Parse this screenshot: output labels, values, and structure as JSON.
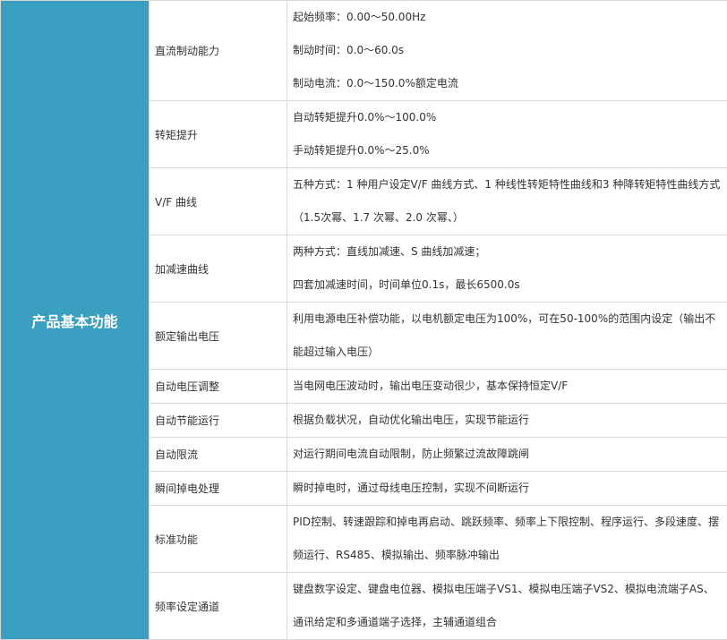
{
  "category": "产品基本功能",
  "rows": [
    {
      "label": "直流制动能力",
      "lines": [
        "起始频率：0.00～50.00Hz",
        "制动时间：0.0～60.0s",
        "制动电流：0.0～150.0%额定电流"
      ]
    },
    {
      "label": "转矩提升",
      "lines": [
        "自动转矩提升0.0%～100.0%",
        "手动转矩提升0.0%～25.0%"
      ]
    },
    {
      "label": "V/F 曲线",
      "lines": [
        "五种方式：1 种用户设定V/F 曲线方式、1 种线性转矩特性曲线和3 种降转矩特性曲线方式",
        "（1.5次幂、1.7 次幂、2.0 次幂、）"
      ]
    },
    {
      "label": "加减速曲线",
      "lines": [
        "两种方式：直线加减速、S 曲线加减速；",
        "四套加减速时间，时间单位0.1s，最长6500.0s"
      ]
    },
    {
      "label": "额定输出电压",
      "lines": [
        "利用电源电压补偿功能，以电机额定电压为100%，可在50-100%的范围内设定（输出不",
        "能超过输入电压）"
      ]
    },
    {
      "label": "自动电压调整",
      "lines": [
        "当电网电压波动时，输出电压变动很少，基本保持恒定V/F"
      ]
    },
    {
      "label": "自动节能运行",
      "lines": [
        "根据负载状况，自动优化输出电压，实现节能运行"
      ]
    },
    {
      "label": "自动限流",
      "lines": [
        "对运行期间电流自动限制，防止频繁过流故障跳闸"
      ]
    },
    {
      "label": "瞬间掉电处理",
      "lines": [
        "瞬时掉电时，通过母线电压控制，实现不间断运行"
      ]
    },
    {
      "label": "标准功能",
      "lines": [
        "PID控制、转速跟踪和掉电再启动、跳跃频率、频率上下限控制、程序运行、多段速度、摆",
        "频运行、RS485、模拟输出、频率脉冲输出"
      ]
    },
    {
      "label": "频率设定通道",
      "lines": [
        "键盘数字设定、键盘电位器、模拟电压端子VS1、模拟电压端子VS2、模拟电流端子AS、",
        "通讯给定和多通道端子选择，主辅通道组合"
      ]
    }
  ]
}
